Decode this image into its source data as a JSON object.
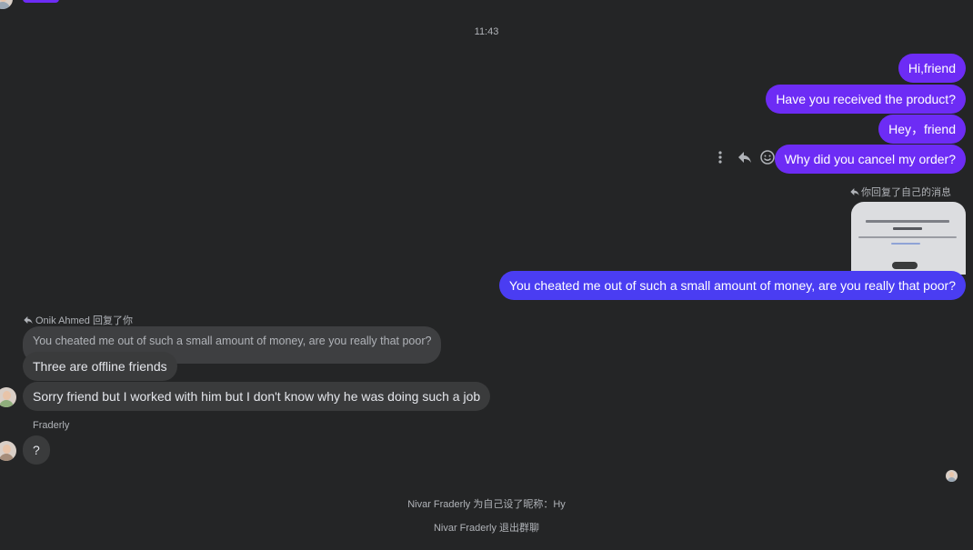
{
  "timestamp": "11:43",
  "outgoing_messages": [
    {
      "text": "Hi,friend"
    },
    {
      "text": "Have you received the product?"
    },
    {
      "text": "Hey，friend"
    },
    {
      "text": "Why did you cancel my order?"
    }
  ],
  "self_reply": {
    "label": "你回复了自己的消息",
    "image_caption": "[图片]",
    "message": "You cheated me out of such a small amount of money, are you really that poor?"
  },
  "incoming_reply": {
    "label": "Onik Ahmed 回复了你",
    "quoted": "You cheated me out of such a small amount of money, are you really that poor?",
    "message": "Three are offline friends"
  },
  "incoming_messages": [
    {
      "text": "Sorry friend but I worked with him but I don't know why he was doing such a job"
    }
  ],
  "fraderly": {
    "sender_name": "Fraderly",
    "message": "?"
  },
  "system_notices": [
    "Nivar Fraderly 为自己设了昵称：Hy",
    "Nivar Fraderly 退出群聊"
  ],
  "icons": {
    "more": "more-vertical-icon",
    "reply": "reply-icon",
    "react": "smiley-icon"
  },
  "colors": {
    "background": "#242526",
    "outgoing_bubble": "#6d2cf5",
    "incoming_bubble": "#3a3b3c"
  }
}
